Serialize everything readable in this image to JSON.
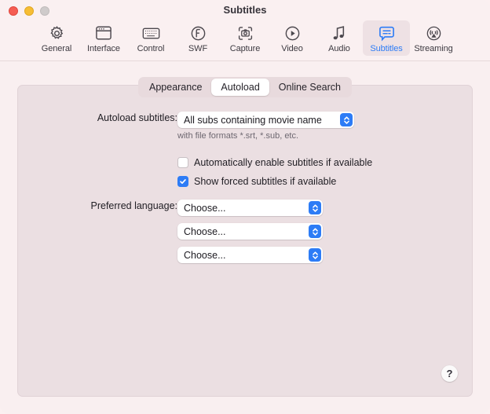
{
  "window": {
    "title": "Subtitles",
    "traffic_lights": [
      {
        "name": "close",
        "color": "#f55c52"
      },
      {
        "name": "minimize",
        "color": "#f6bd34"
      },
      {
        "name": "zoom",
        "color": "#cfcbcb"
      }
    ]
  },
  "toolbar": {
    "items": [
      {
        "label": "General",
        "icon": "gear-icon",
        "selected": false
      },
      {
        "label": "Interface",
        "icon": "window-icon",
        "selected": false
      },
      {
        "label": "Control",
        "icon": "keyboard-icon",
        "selected": false
      },
      {
        "label": "SWF",
        "icon": "flash-icon",
        "selected": false
      },
      {
        "label": "Capture",
        "icon": "camera-icon",
        "selected": false
      },
      {
        "label": "Video",
        "icon": "play-icon",
        "selected": false
      },
      {
        "label": "Audio",
        "icon": "music-note-icon",
        "selected": false
      },
      {
        "label": "Subtitles",
        "icon": "speech-bubble-icon",
        "selected": true
      },
      {
        "label": "Streaming",
        "icon": "airplay-icon",
        "selected": false
      }
    ],
    "selected_color": "#2d7cf6"
  },
  "tabs": {
    "items": [
      {
        "label": "Appearance",
        "active": false
      },
      {
        "label": "Autoload",
        "active": true
      },
      {
        "label": "Online Search",
        "active": false
      }
    ]
  },
  "form": {
    "autoload_label": "Autoload subtitles:",
    "autoload_value": "All subs containing movie name",
    "autoload_hint": "with file formats *.srt, *.sub, etc.",
    "checkbox_auto_enable": {
      "label": "Automatically enable subtitles if available",
      "checked": false
    },
    "checkbox_forced": {
      "label": "Show forced subtitles if available",
      "checked": true
    },
    "preferred_language_label": "Preferred language:",
    "language_rows": [
      {
        "value": "Choose..."
      },
      {
        "value": "Choose..."
      },
      {
        "value": "Choose..."
      }
    ]
  },
  "help": {
    "label": "?"
  },
  "colors": {
    "accent": "#2d7cf6",
    "window_bg": "#f9eff0",
    "panel_bg": "#ebdfe2"
  }
}
